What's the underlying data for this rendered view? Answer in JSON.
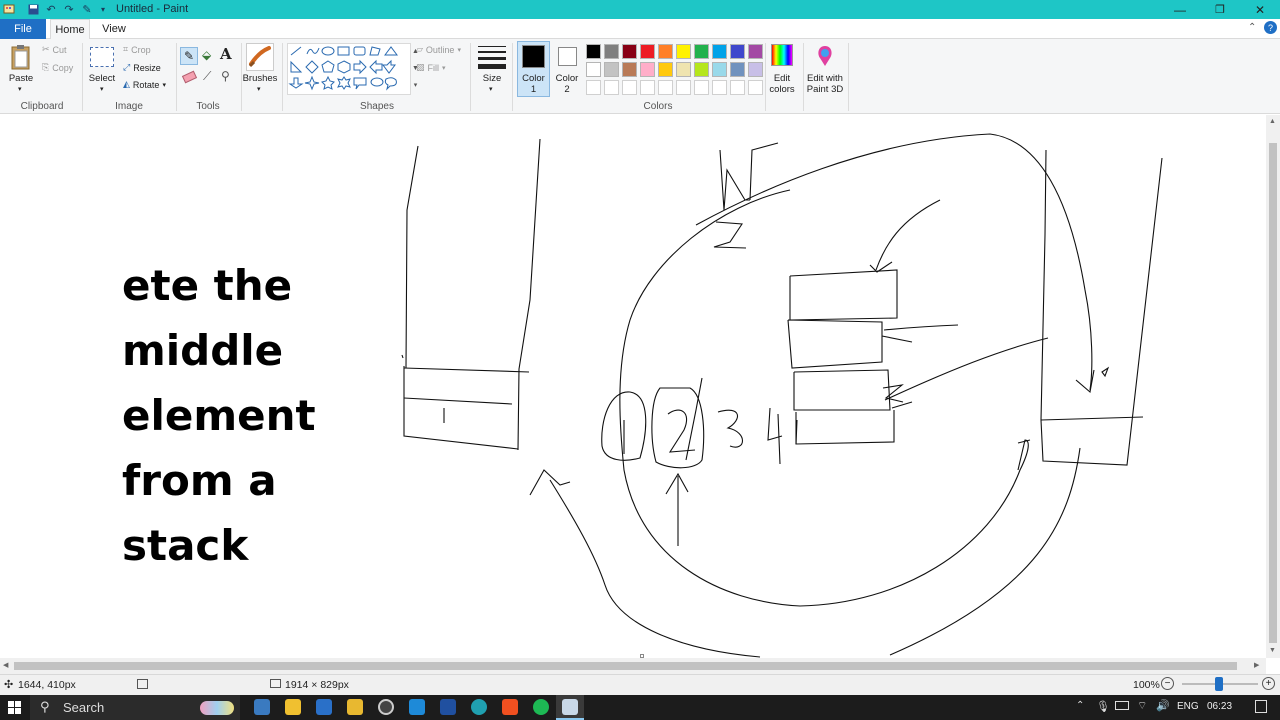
{
  "window": {
    "title": "Untitled - Paint",
    "controls": {
      "minimize": "—",
      "maximize": "❐",
      "close": "✕"
    }
  },
  "tabs": [
    {
      "label": "File"
    },
    {
      "label": "Home"
    },
    {
      "label": "View"
    }
  ],
  "ribbon": {
    "clipboard": {
      "paste": "Paste",
      "cut": "Cut",
      "copy": "Copy",
      "group": "Clipboard"
    },
    "image": {
      "select": "Select",
      "crop": "Crop",
      "resize": "Resize",
      "rotate": "Rotate",
      "group": "Image"
    },
    "tools": {
      "group": "Tools",
      "text_icon": "A"
    },
    "brushes": {
      "label": "Brushes"
    },
    "shapes": {
      "outline": "Outline",
      "fill": "Fill",
      "group": "Shapes"
    },
    "size": {
      "label": "Size"
    },
    "color1": {
      "label": "Color",
      "sub": "1",
      "value": "#000000"
    },
    "color2": {
      "label": "Color",
      "sub": "2",
      "value": "#ffffff"
    },
    "palette_row1": [
      "#000000",
      "#7f7f7f",
      "#880015",
      "#ed1c24",
      "#ff7f27",
      "#fff200",
      "#22b14c",
      "#00a2e8",
      "#3f48cc",
      "#a349a4"
    ],
    "palette_row2": [
      "#ffffff",
      "#c3c3c3",
      "#b97a57",
      "#ffaec9",
      "#ffc90e",
      "#efe4b0",
      "#b5e61d",
      "#99d9ea",
      "#7092be",
      "#c8bfe7"
    ],
    "colors_group": "Colors",
    "edit_colors": {
      "line1": "Edit",
      "line2": "colors"
    },
    "paint3d": {
      "line1": "Edit with",
      "line2": "Paint 3D"
    }
  },
  "canvas": {
    "text_lines": [
      "ete the",
      "middle",
      "element",
      "from a",
      "stack"
    ],
    "digits": [
      "1",
      "2",
      "3",
      "4"
    ]
  },
  "status": {
    "cursor_pos": "1644, 410px",
    "canvas_size": "1914 × 829px",
    "zoom": "100%"
  },
  "taskbar": {
    "search_placeholder": "Search",
    "language": "ENG",
    "time": "06:23"
  }
}
